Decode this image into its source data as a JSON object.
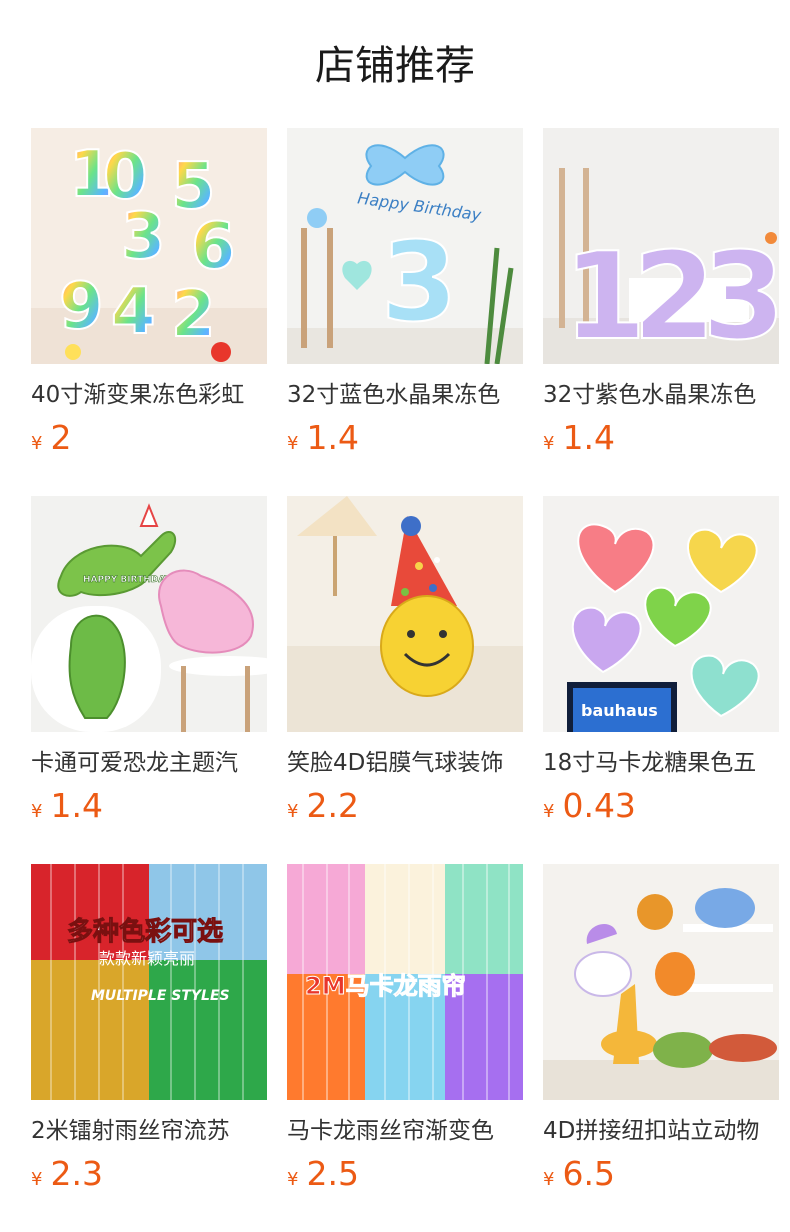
{
  "header": {
    "title": "店铺推荐"
  },
  "currency_symbol": "¥",
  "products": [
    {
      "name": "40寸渐变果冻色彩虹",
      "price": "2",
      "image": "rainbow-jelly-number-balloons"
    },
    {
      "name": "32寸蓝色水晶果冻色",
      "price": "1.4",
      "image": "blue-crystal-number-3-balloon"
    },
    {
      "name": "32寸紫色水晶果冻色",
      "price": "1.4",
      "image": "purple-crystal-number-balloons"
    },
    {
      "name": "卡通可爱恐龙主题汽",
      "price": "1.4",
      "image": "cartoon-dinosaur-balloons"
    },
    {
      "name": "笑脸4D铝膜气球装饰",
      "price": "2.2",
      "image": "smiley-party-hat-balloon"
    },
    {
      "name": "18寸马卡龙糖果色五",
      "price": "0.43",
      "image": "macaron-heart-balloons"
    },
    {
      "name": "2米镭射雨丝帘流苏",
      "price": "2.3",
      "image": "laser-tinsel-curtains"
    },
    {
      "name": "马卡龙雨丝帘渐变色",
      "price": "2.5",
      "image": "macaron-tinsel-curtains"
    },
    {
      "name": "4D拼接纽扣站立动物",
      "price": "6.5",
      "image": "standing-animal-balloons"
    }
  ],
  "image_text": {
    "p2_banner": "Happy Birthday",
    "p2_digit": "3",
    "p3_digits": "123",
    "p4_sign": "HAPPY BIRTHDAY",
    "p6_sign": "bauhaus",
    "p7_title": "多种色彩可选",
    "p7_subtitle": "款款新颖亮丽",
    "p7_caption": "MULTIPLE STYLES",
    "p8_title": "2M马卡龙雨帘"
  }
}
